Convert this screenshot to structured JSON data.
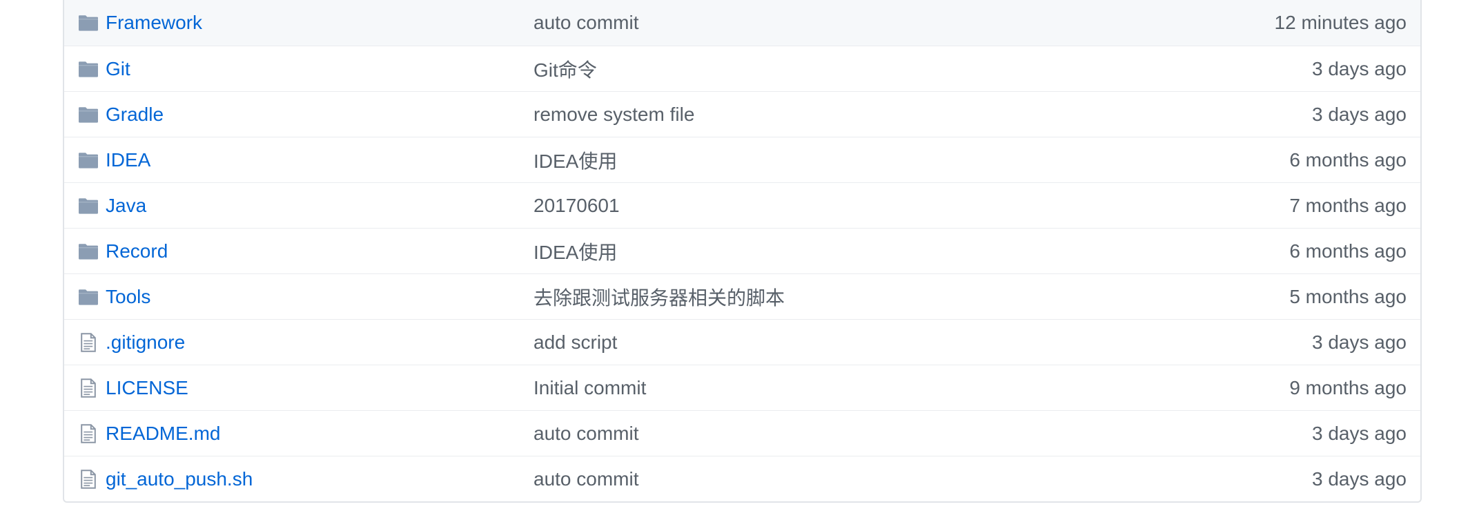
{
  "colors": {
    "link": "#0366d6",
    "muted_text": "#586069",
    "folder_icon": "#79b8ff",
    "file_icon": "#6a737d",
    "border": "#e1e4e8"
  },
  "files": [
    {
      "type": "folder",
      "icon": "folder-icon",
      "name": "Framework",
      "message": "auto commit",
      "age": "12 minutes ago"
    },
    {
      "type": "folder",
      "icon": "folder-icon",
      "name": "Git",
      "message": "Git命令",
      "age": "3 days ago"
    },
    {
      "type": "folder",
      "icon": "folder-icon",
      "name": "Gradle",
      "message": "remove system file",
      "age": "3 days ago"
    },
    {
      "type": "folder",
      "icon": "folder-icon",
      "name": "IDEA",
      "message": "IDEA使用",
      "age": "6 months ago"
    },
    {
      "type": "folder",
      "icon": "folder-icon",
      "name": "Java",
      "message": "20170601",
      "age": "7 months ago"
    },
    {
      "type": "folder",
      "icon": "folder-icon",
      "name": "Record",
      "message": "IDEA使用",
      "age": "6 months ago"
    },
    {
      "type": "folder",
      "icon": "folder-icon",
      "name": "Tools",
      "message": "去除跟测试服务器相关的脚本",
      "age": "5 months ago"
    },
    {
      "type": "file",
      "icon": "file-icon",
      "name": ".gitignore",
      "message": "add script",
      "age": "3 days ago"
    },
    {
      "type": "file",
      "icon": "file-icon",
      "name": "LICENSE",
      "message": "Initial commit",
      "age": "9 months ago"
    },
    {
      "type": "file",
      "icon": "file-icon",
      "name": "README.md",
      "message": "auto commit",
      "age": "3 days ago"
    },
    {
      "type": "file",
      "icon": "file-icon",
      "name": "git_auto_push.sh",
      "message": "auto commit",
      "age": "3 days ago"
    }
  ]
}
